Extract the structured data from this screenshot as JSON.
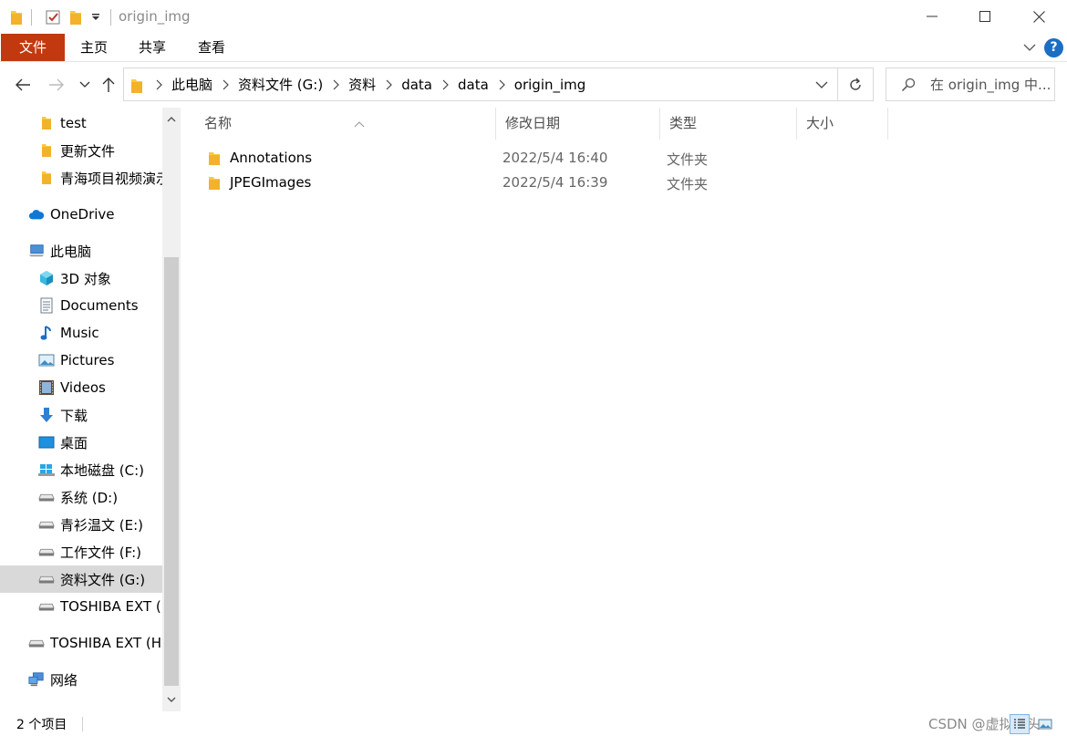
{
  "window": {
    "title": "origin_img"
  },
  "ribbon": {
    "tabs": [
      "文件",
      "主页",
      "共享",
      "查看"
    ]
  },
  "address": {
    "crumbs": [
      "此电脑",
      "资料文件 (G:)",
      "资料",
      "data",
      "data",
      "origin_img"
    ]
  },
  "search": {
    "placeholder": "在 origin_img 中..."
  },
  "navpane": {
    "items": [
      {
        "label": "test",
        "icon": "folder-icon"
      },
      {
        "label": "更新文件",
        "icon": "folder-icon"
      },
      {
        "label": "青海项目视频演示",
        "icon": "folder-icon"
      },
      {
        "label": "OneDrive",
        "icon": "onedrive-cloud-icon"
      },
      {
        "label": "此电脑",
        "icon": "this-pc-icon"
      },
      {
        "label": "3D 对象",
        "icon": "3d-objects-icon"
      },
      {
        "label": "Documents",
        "icon": "documents-icon"
      },
      {
        "label": "Music",
        "icon": "music-note-icon"
      },
      {
        "label": "Pictures",
        "icon": "pictures-icon"
      },
      {
        "label": "Videos",
        "icon": "videos-icon"
      },
      {
        "label": "下载",
        "icon": "download-arrow-icon"
      },
      {
        "label": "桌面",
        "icon": "desktop-icon"
      },
      {
        "label": "本地磁盘 (C:)",
        "icon": "windows-drive-icon"
      },
      {
        "label": "系统 (D:)",
        "icon": "drive-icon"
      },
      {
        "label": "青衫温文 (E:)",
        "icon": "drive-icon"
      },
      {
        "label": "工作文件 (F:)",
        "icon": "drive-icon"
      },
      {
        "label": "资料文件 (G:)",
        "icon": "drive-icon",
        "selected": true
      },
      {
        "label": "TOSHIBA EXT (H:)",
        "icon": "drive-icon"
      },
      {
        "label": "TOSHIBA EXT (H:)",
        "icon": "drive-icon"
      },
      {
        "label": "网络",
        "icon": "network-icon"
      }
    ]
  },
  "columns": {
    "name": "名称",
    "date": "修改日期",
    "type": "类型",
    "size": "大小"
  },
  "files": [
    {
      "name": "Annotations",
      "date": "2022/5/4 16:40",
      "type": "文件夹"
    },
    {
      "name": "JPEGImages",
      "date": "2022/5/4 16:39",
      "type": "文件夹"
    }
  ],
  "status": {
    "count": "2 个项目",
    "watermark": "CSDN @虚拟掉头"
  },
  "colors": {
    "file_tab": "#c2390f",
    "folder_yellow": "#ffc83d",
    "accent_blue": "#1b6ec2",
    "selection": "#d9d9d9"
  }
}
